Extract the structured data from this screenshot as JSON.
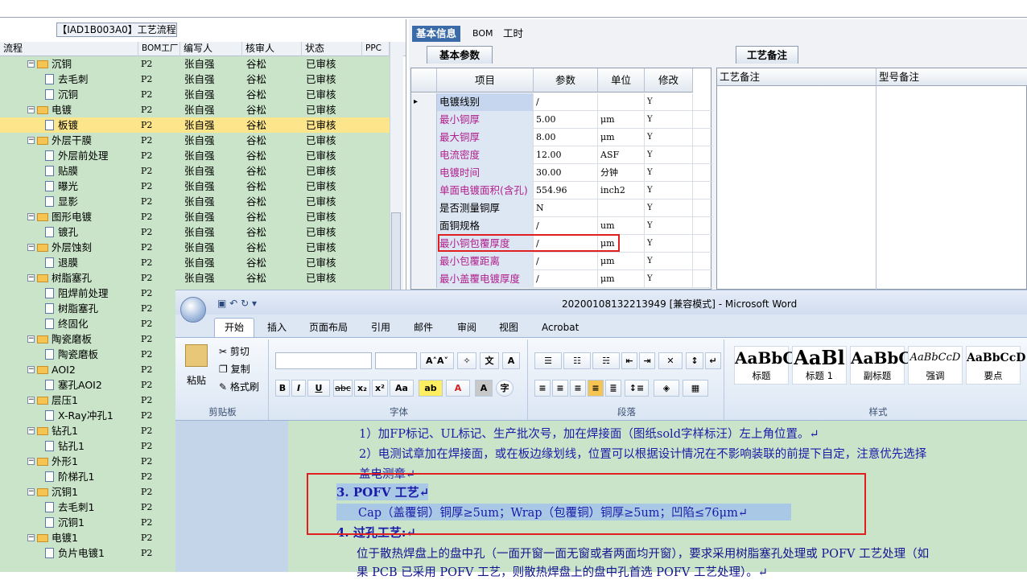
{
  "left_panel": {
    "title": "【IAD1B003A0】工艺流程",
    "headers": [
      "流程",
      "BOM工厂",
      "编写人",
      "核审人",
      "状态",
      "PPC"
    ],
    "rows": [
      {
        "level": 1,
        "type": "folder",
        "name": "沉铜",
        "code": "P2",
        "writer": "张自强",
        "reviewer": "谷松",
        "status": "已审核"
      },
      {
        "level": 2,
        "type": "doc",
        "name": "去毛刺",
        "code": "P2",
        "writer": "张自强",
        "reviewer": "谷松",
        "status": "已审核"
      },
      {
        "level": 2,
        "type": "doc",
        "name": "沉铜",
        "code": "P2",
        "writer": "张自强",
        "reviewer": "谷松",
        "status": "已审核"
      },
      {
        "level": 1,
        "type": "folder",
        "name": "电镀",
        "code": "P2",
        "writer": "张自强",
        "reviewer": "谷松",
        "status": "已审核"
      },
      {
        "level": 2,
        "type": "doc",
        "name": "板镀",
        "code": "P2",
        "writer": "张自强",
        "reviewer": "谷松",
        "status": "已审核",
        "selected": true
      },
      {
        "level": 1,
        "type": "folder",
        "name": "外层干膜",
        "code": "P2",
        "writer": "张自强",
        "reviewer": "谷松",
        "status": "已审核"
      },
      {
        "level": 2,
        "type": "doc",
        "name": "外层前处理",
        "code": "P2",
        "writer": "张自强",
        "reviewer": "谷松",
        "status": "已审核"
      },
      {
        "level": 2,
        "type": "doc",
        "name": "贴膜",
        "code": "P2",
        "writer": "张自强",
        "reviewer": "谷松",
        "status": "已审核"
      },
      {
        "level": 2,
        "type": "doc",
        "name": "曝光",
        "code": "P2",
        "writer": "张自强",
        "reviewer": "谷松",
        "status": "已审核"
      },
      {
        "level": 2,
        "type": "doc",
        "name": "显影",
        "code": "P2",
        "writer": "张自强",
        "reviewer": "谷松",
        "status": "已审核"
      },
      {
        "level": 1,
        "type": "folder",
        "name": "图形电镀",
        "code": "P2",
        "writer": "张自强",
        "reviewer": "谷松",
        "status": "已审核"
      },
      {
        "level": 2,
        "type": "doc",
        "name": "镀孔",
        "code": "P2",
        "writer": "张自强",
        "reviewer": "谷松",
        "status": "已审核"
      },
      {
        "level": 1,
        "type": "folder",
        "name": "外层蚀刻",
        "code": "P2",
        "writer": "张自强",
        "reviewer": "谷松",
        "status": "已审核"
      },
      {
        "level": 2,
        "type": "doc",
        "name": "退膜",
        "code": "P2",
        "writer": "张自强",
        "reviewer": "谷松",
        "status": "已审核"
      },
      {
        "level": 1,
        "type": "folder",
        "name": "树脂塞孔",
        "code": "P2",
        "writer": "张自强",
        "reviewer": "谷松",
        "status": "已审核"
      },
      {
        "level": 2,
        "type": "doc",
        "name": "阻焊前处理",
        "code": "P2",
        "writer": "",
        "reviewer": "",
        "status": ""
      },
      {
        "level": 2,
        "type": "doc",
        "name": "树脂塞孔",
        "code": "P2",
        "writer": "",
        "reviewer": "",
        "status": ""
      },
      {
        "level": 2,
        "type": "doc",
        "name": "终固化",
        "code": "P2",
        "writer": "",
        "reviewer": "",
        "status": ""
      },
      {
        "level": 1,
        "type": "folder",
        "name": "陶瓷磨板",
        "code": "P2",
        "writer": "",
        "reviewer": "",
        "status": ""
      },
      {
        "level": 2,
        "type": "doc",
        "name": "陶瓷磨板",
        "code": "P2",
        "writer": "",
        "reviewer": "",
        "status": ""
      },
      {
        "level": 1,
        "type": "folder",
        "name": "AOI2",
        "code": "P2",
        "writer": "",
        "reviewer": "",
        "status": ""
      },
      {
        "level": 2,
        "type": "doc",
        "name": "塞孔AOI2",
        "code": "P2",
        "writer": "",
        "reviewer": "",
        "status": ""
      },
      {
        "level": 1,
        "type": "folder",
        "name": "层压1",
        "code": "P2",
        "writer": "",
        "reviewer": "",
        "status": ""
      },
      {
        "level": 2,
        "type": "doc",
        "name": "X-Ray冲孔1",
        "code": "P2",
        "writer": "",
        "reviewer": "",
        "status": ""
      },
      {
        "level": 1,
        "type": "folder",
        "name": "钻孔1",
        "code": "P2",
        "writer": "",
        "reviewer": "",
        "status": ""
      },
      {
        "level": 2,
        "type": "doc",
        "name": "钻孔1",
        "code": "P2",
        "writer": "",
        "reviewer": "",
        "status": ""
      },
      {
        "level": 1,
        "type": "folder",
        "name": "外形1",
        "code": "P2",
        "writer": "",
        "reviewer": "",
        "status": ""
      },
      {
        "level": 2,
        "type": "doc",
        "name": "阶梯孔1",
        "code": "P2",
        "writer": "",
        "reviewer": "",
        "status": ""
      },
      {
        "level": 1,
        "type": "folder",
        "name": "沉铜1",
        "code": "P2",
        "writer": "",
        "reviewer": "",
        "status": ""
      },
      {
        "level": 2,
        "type": "doc",
        "name": "去毛刺1",
        "code": "P2",
        "writer": "",
        "reviewer": "",
        "status": ""
      },
      {
        "level": 2,
        "type": "doc",
        "name": "沉铜1",
        "code": "P2",
        "writer": "",
        "reviewer": "",
        "status": ""
      },
      {
        "level": 1,
        "type": "folder",
        "name": "电镀1",
        "code": "P2",
        "writer": "",
        "reviewer": "",
        "status": ""
      },
      {
        "level": 2,
        "type": "doc",
        "name": "负片电镀1",
        "code": "P2",
        "writer": "",
        "reviewer": "",
        "status": ""
      }
    ]
  },
  "right_panel": {
    "tabs": [
      "基本信息",
      "BOM",
      "工时"
    ],
    "params_tab": "基本参数",
    "notes_tab": "工艺备注",
    "grid_headers": [
      "项目",
      "参数",
      "单位",
      "修改"
    ],
    "grid_rows": [
      {
        "name": "电镀线别",
        "value": "/",
        "unit": "",
        "mod": "Y",
        "color": "#000000"
      },
      {
        "name": "最小铜厚",
        "value": "5.00",
        "unit": "μm",
        "mod": "Y",
        "color": "#b0208c"
      },
      {
        "name": "最大铜厚",
        "value": "8.00",
        "unit": "μm",
        "mod": "Y",
        "color": "#b0208c"
      },
      {
        "name": "电流密度",
        "value": "12.00",
        "unit": "ASF",
        "mod": "Y",
        "color": "#b0208c"
      },
      {
        "name": "电镀时间",
        "value": "30.00",
        "unit": "分钟",
        "mod": "Y",
        "color": "#b0208c"
      },
      {
        "name": "单面电镀面积(含孔)",
        "value": "554.96",
        "unit": "inch2",
        "mod": "Y",
        "color": "#b0208c"
      },
      {
        "name": "是否测量铜厚",
        "value": "N",
        "unit": "",
        "mod": "Y",
        "color": "#000000"
      },
      {
        "name": "面铜规格",
        "value": "/",
        "unit": "um",
        "mod": "Y",
        "color": "#000000"
      },
      {
        "name": "最小铜包覆厚度",
        "value": "/",
        "unit": "μm",
        "mod": "Y",
        "color": "#b0208c"
      },
      {
        "name": "最小包覆距离",
        "value": "/",
        "unit": "μm",
        "mod": "Y",
        "color": "#b0208c"
      },
      {
        "name": "最小盖覆电镀厚度",
        "value": "/",
        "unit": "μm",
        "mod": "Y",
        "color": "#b0208c"
      }
    ],
    "note_headers": [
      "工艺备注",
      "型号备注"
    ]
  },
  "word": {
    "title": "20200108132213949 [兼容模式] - Microsoft Word",
    "tabs": [
      "开始",
      "插入",
      "页面布局",
      "引用",
      "邮件",
      "审阅",
      "视图",
      "Acrobat"
    ],
    "clipboard": {
      "paste": "粘贴",
      "cut": "剪切",
      "copy": "复制",
      "format": "格式刷",
      "label": "剪贴板"
    },
    "font_label": "字体",
    "para_label": "段落",
    "styles_label": "样式",
    "styles": [
      {
        "sample": "AaBbC",
        "name": "标题"
      },
      {
        "sample": "AaBl",
        "name": "标题 1"
      },
      {
        "sample": "AaBbC",
        "name": "副标题"
      },
      {
        "sample": "AaBbCcD",
        "name": "强调"
      },
      {
        "sample": "AaBbCcD",
        "name": "要点"
      }
    ],
    "doc_lines": [
      "1）加FP标记、UL标记、生产批次号，加在焊接面（图纸sold字样标汪）左上角位置。↵",
      "2）电测试章加在焊接面，或在板边缘划线，位置可以根据设计情况在不影响装联的前提下自定，注意优先选择",
      "盖电测章↵",
      "3. POFV 工艺↵",
      "Cap（盖覆铜）铜厚≥5um；Wrap（包覆铜）铜厚≥5um；凹陷≤76μm↵",
      "4. 过孔工艺:↵",
      "位于散热焊盘上的盘中孔（一面开窗一面无窗或者两面均开窗），要求采用树脂塞孔处理或 POFV 工艺处理（如",
      "果 PCB 已采用 POFV 工艺，则散热焊盘上的盘中孔首选 POFV 工艺处理）。↵"
    ]
  }
}
